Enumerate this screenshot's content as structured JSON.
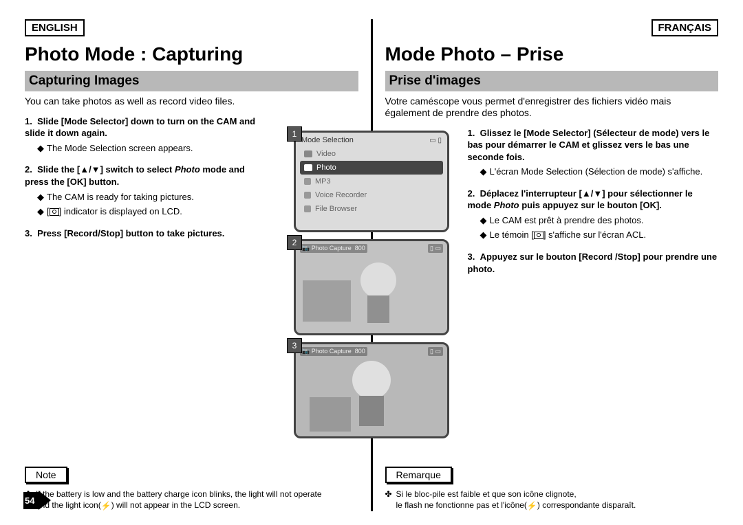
{
  "page_number": "54",
  "english": {
    "lang_label": "ENGLISH",
    "title": "Photo Mode : Capturing",
    "subtitle": "Capturing Images",
    "intro": "You can take photos as well as record video files.",
    "step1_head": "Slide [Mode Selector] down to turn on the CAM and slide it down again.",
    "step1_sub1": "The Mode Selection screen appears.",
    "step2_pre": "Slide the [",
    "step2_mid": "] switch to select ",
    "step2_em": "Photo",
    "step2_post": " mode and press the [OK] button.",
    "step2_sub1": "The CAM is ready for taking pictures.",
    "step2_sub2_pre": "[",
    "step2_sub2_post": "] indicator is displayed on LCD.",
    "step3_head": "Press [Record/Stop] button to take pictures.",
    "note_label": "Note",
    "note_l1": "If the battery is low and the battery charge icon blinks, the light will not operate",
    "note_l2_pre": "and the light icon(",
    "note_l2_post": ") will not appear in the LCD screen."
  },
  "french": {
    "lang_label": "FRANÇAIS",
    "title": "Mode Photo – Prise",
    "subtitle": "Prise d'images",
    "intro": "Votre caméscope vous permet d'enregistrer des fichiers vidéo mais également de prendre des photos.",
    "step1_head": "Glissez le [Mode Selector] (Sélecteur de mode) vers le bas pour démarrer le CAM et glissez vers le bas une seconde fois.",
    "step1_sub1": "L'écran Mode Selection (Sélection de mode) s'affiche.",
    "step2_pre": "Déplacez l'interrupteur [",
    "step2_mid": "] pour sélectionner le mode ",
    "step2_em": "Photo",
    "step2_post": " puis appuyez sur le bouton [OK].",
    "step2_sub1": "Le CAM est prêt à prendre des photos.",
    "step2_sub2_pre": "Le témoin [",
    "step2_sub2_post": "] s'affiche sur l'écran ACL.",
    "step3_head": "Appuyez sur le bouton [Record /Stop] pour prendre une photo.",
    "note_label": "Remarque",
    "note_l1": "Si le bloc-pile est faible et que son icône clignote,",
    "note_l2_pre": "le flash ne fonctionne pas et l'icône(",
    "note_l2_post": ") correspondante disparaît."
  },
  "figures": {
    "num1": "1",
    "num2": "2",
    "num3": "3",
    "mode_sel_title": "Mode Selection",
    "menu_video": "Video",
    "menu_photo": "Photo",
    "menu_mp3": "MP3",
    "menu_voice": "Voice Recorder",
    "menu_file": "File Browser",
    "capture_label": "Photo Capture",
    "res_label": "800"
  }
}
